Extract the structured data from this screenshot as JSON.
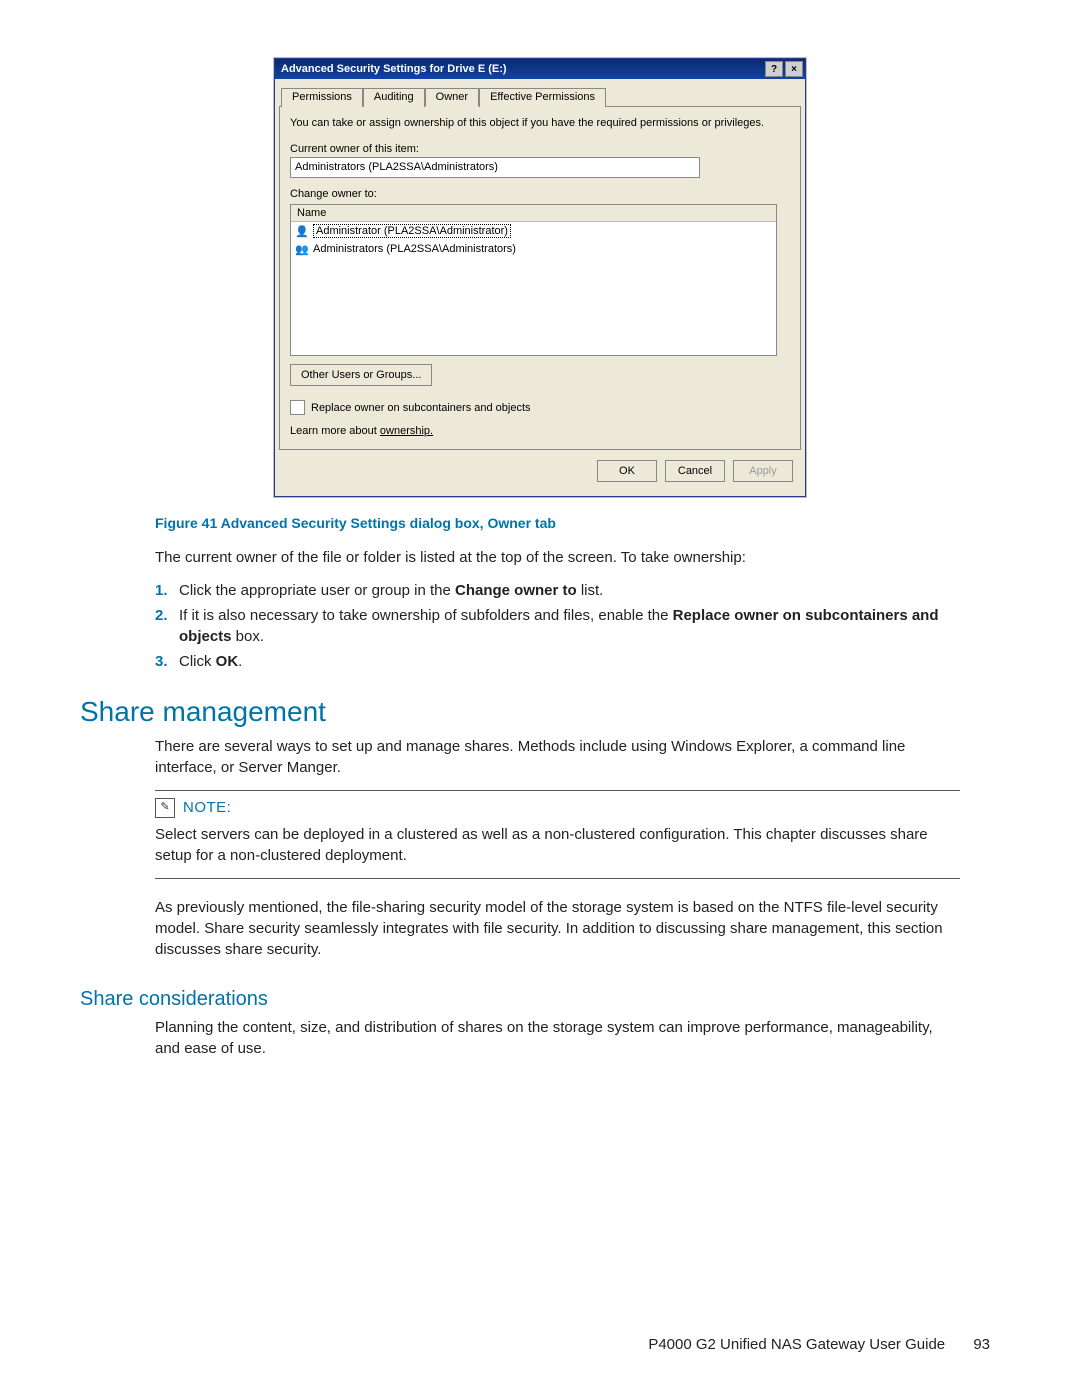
{
  "dialog": {
    "title": "Advanced Security Settings for Drive E (E:)",
    "tabs": [
      "Permissions",
      "Auditing",
      "Owner",
      "Effective Permissions"
    ],
    "active_tab": "Owner",
    "description": "You can take or assign ownership of this object if you have the required permissions or privileges.",
    "current_owner_label": "Current owner of this item:",
    "current_owner_value": "Administrators (PLA2SSA\\Administrators)",
    "change_owner_label": "Change owner to:",
    "list_header": "Name",
    "owner_options": [
      "Administrator (PLA2SSA\\Administrator)",
      "Administrators (PLA2SSA\\Administrators)"
    ],
    "other_users_btn": "Other Users or Groups...",
    "replace_checkbox": "Replace owner on subcontainers and objects",
    "learn_more_prefix": "Learn more about ",
    "learn_more_link": "ownership.",
    "buttons": {
      "ok": "OK",
      "cancel": "Cancel",
      "apply": "Apply"
    }
  },
  "caption": "Figure 41 Advanced Security Settings dialog box, Owner tab",
  "intro": "The current owner of the file or folder is listed at the top of the screen. To take ownership:",
  "steps": [
    {
      "n": "1.",
      "pre": "Click the appropriate user or group in the ",
      "bold": "Change owner to",
      "post": " list."
    },
    {
      "n": "2.",
      "pre": "If it is also necessary to take ownership of subfolders and files, enable the ",
      "bold": "Replace owner on subcontainers and objects",
      "post": " box."
    },
    {
      "n": "3.",
      "pre": "Click ",
      "bold": "OK",
      "post": "."
    }
  ],
  "share_mgmt": {
    "heading": "Share management",
    "para": "There are several ways to set up and manage shares. Methods include using Windows Explorer, a command line interface, or Server Manger."
  },
  "note": {
    "label": "NOTE:",
    "body": "Select servers can be deployed in a clustered as well as a non-clustered configuration. This chapter discusses share setup for a non-clustered deployment."
  },
  "after_note": "As previously mentioned, the file-sharing security model of the storage system is based on the NTFS file-level security model. Share security seamlessly integrates with file security. In addition to discussing share management, this section discusses share security.",
  "share_cons": {
    "heading": "Share considerations",
    "para": "Planning the content, size, and distribution of shares on the storage system can improve performance, manageability, and ease of use."
  },
  "footer": {
    "doc": "P4000 G2 Unified NAS Gateway User Guide",
    "page": "93"
  }
}
